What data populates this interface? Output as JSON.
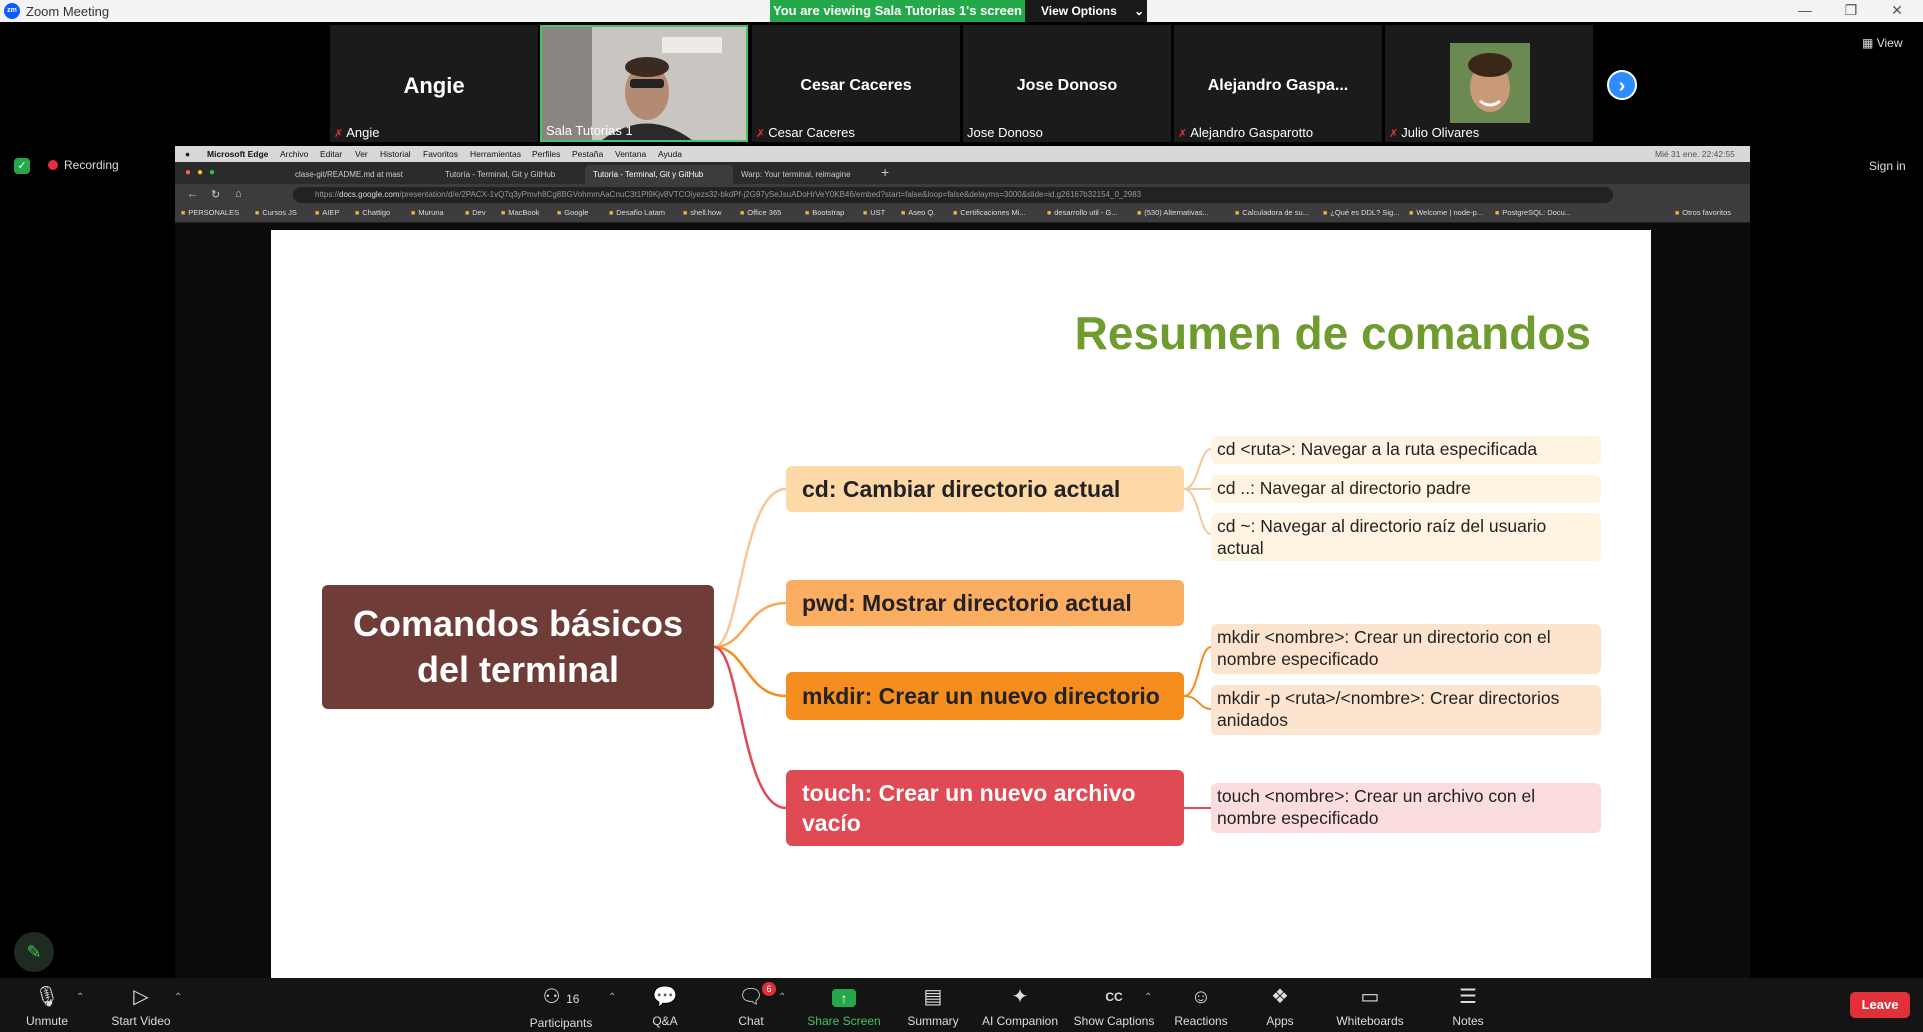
{
  "window": {
    "title": "Zoom Meeting",
    "app_badge": "zm"
  },
  "share_banner": {
    "text": "You are viewing Sala Tutorias 1's screen",
    "view_options": "View Options"
  },
  "gallery": {
    "participants": [
      {
        "display": "Angie",
        "caption": "Angie",
        "muted": true
      },
      {
        "display": "",
        "caption": "Sala Tutorias 1",
        "muted": false,
        "active": true
      },
      {
        "display": "Cesar Caceres",
        "caption": "Cesar Caceres",
        "muted": true
      },
      {
        "display": "Jose Donoso",
        "caption": "Jose Donoso",
        "muted": false
      },
      {
        "display": "Alejandro  Gaspa...",
        "caption": "Alejandro Gasparotto",
        "muted": true
      },
      {
        "display": "",
        "caption": "Julio Olivares",
        "muted": true
      }
    ],
    "view_label": "View"
  },
  "side": {
    "recording": "Recording",
    "sign_in": "Sign in"
  },
  "mac_menu": [
    "Microsoft Edge",
    "Archivo",
    "Editar",
    "Ver",
    "Historial",
    "Favoritos",
    "Herramientas",
    "Perfiles",
    "Pestaña",
    "Ventana",
    "Ayuda"
  ],
  "mac_status": "Mié 31 ene. 22:42:55",
  "browser": {
    "tabs": [
      "clase-git/README.md at mast",
      "Tutoría - Terminal, Git y GitHub",
      "Tutoría - Terminal, Git y GitHub",
      "Warp: Your terminal, reimagine"
    ],
    "url_prefix": "https://",
    "url_host": "docs.google.com",
    "url_path": "/presentation/d/e/2PACX-1vQ7q3yPmvh8Cg8BGVohmmAaCnuC3t1Pl9Kjv8VTCOiyezs32-bkdPf-j2G97ySeJsuADoHrVeY0KB46/embed?start=false&loop=false&delayms=3000&slide=id.g26167b32154_0_2983",
    "bookmarks": [
      "PERSONALES",
      "Cursos JS",
      "AIEP",
      "Chattigo",
      "Muruna",
      "Dev",
      "MacBook",
      "Google",
      "Desafío Latam",
      "shell.how",
      "Office 365",
      "Bootstrap",
      "UST",
      "Aseo Q.",
      "Certificaciones Mi...",
      "desarrollo util - G...",
      "(530) Alternativas...",
      "Calculadora de su...",
      "¿Qué es DDL? Sig...",
      "Welcome | node-p...",
      "PostgreSQL: Docu...",
      "Otros favoritos"
    ]
  },
  "slide": {
    "title": "Resumen de comandos",
    "root": "Comandos básicos del terminal",
    "commands": [
      {
        "label": "cd: Cambiar directorio actual",
        "children": [
          "cd <ruta>: Navegar a la ruta especificada",
          "cd ..: Navegar al directorio padre",
          "cd ~: Navegar al directorio raíz del usuario actual"
        ]
      },
      {
        "label": "pwd: Mostrar directorio actual",
        "children": []
      },
      {
        "label": "mkdir: Crear un nuevo directorio",
        "children": [
          "mkdir <nombre>: Crear un directorio con el nombre especificado",
          "mkdir -p <ruta>/<nombre>: Crear directorios anidados"
        ]
      },
      {
        "label": "touch: Crear un nuevo archivo vacío",
        "children": [
          "touch <nombre>: Crear un archivo con el nombre especificado"
        ]
      }
    ],
    "colors": {
      "title": "#6f9b2f",
      "root": "#6f3c38",
      "cd": "#fdd9a8",
      "pwd": "#fbad62",
      "mkdir": "#f58d1f",
      "touch": "#e04a55"
    }
  },
  "toolbar": {
    "unmute": "Unmute",
    "start_video": "Start Video",
    "participants": "Participants",
    "participants_count": "16",
    "qa": "Q&A",
    "chat": "Chat",
    "chat_badge": "6",
    "share_screen": "Share Screen",
    "summary": "Summary",
    "ai_companion": "AI Companion",
    "show_captions": "Show Captions",
    "reactions": "Reactions",
    "apps": "Apps",
    "whiteboards": "Whiteboards",
    "notes": "Notes",
    "leave": "Leave"
  }
}
